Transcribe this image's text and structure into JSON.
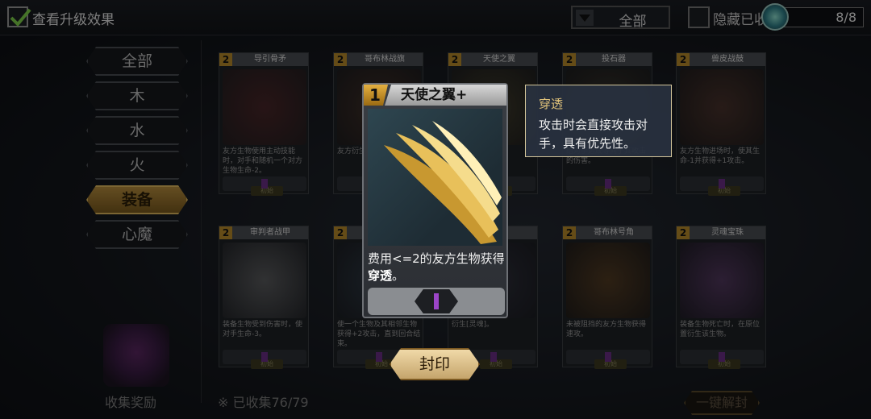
{
  "topbar": {
    "show_upgrade_label": "查看升级效果",
    "filter_value": "全部",
    "hide_label": "隐藏已收",
    "counter": "8/8"
  },
  "sidebar": {
    "items": [
      {
        "label": "全部"
      },
      {
        "label": "木"
      },
      {
        "label": "水"
      },
      {
        "label": "火"
      },
      {
        "label": "装备"
      },
      {
        "label": "心魔"
      }
    ]
  },
  "footer": {
    "chest_label": "收集奖励",
    "collected": "※ 已收集76/79",
    "unseal_all": "一键解封"
  },
  "cards": [
    {
      "cost": "2",
      "name": "导引骨矛",
      "desc": "友方生物使用主动技能时，对手和随机一个对方生物生命-2。",
      "tag": "初始"
    },
    {
      "cost": "2",
      "name": "哥布林战旗",
      "desc": "友方衍生...使其获...",
      "tag": "初始"
    },
    {
      "cost": "2",
      "name": "天使之翼",
      "desc": "...生物",
      "tag": "初始"
    },
    {
      "cost": "2",
      "name": "投石器",
      "desc": "给对手造成等同于其攻击的伤害。",
      "tag": "初始"
    },
    {
      "cost": "2",
      "name": "兽皮战鼓",
      "desc": "友方生物进场时，使其生命-1并获得+1攻击。",
      "tag": "初始"
    },
    {
      "cost": "2",
      "name": "审判者战甲",
      "desc": "装备生物受到伤害时，使对手生命-3。",
      "tag": "初始"
    },
    {
      "cost": "2",
      "name": "",
      "desc": "使一个生物及其相邻生物获得+2攻击，直到回合结束。",
      "tag": "初始"
    },
    {
      "cost": "2",
      "name": "",
      "desc": "衍生[灵魂]。",
      "tag": "初始"
    },
    {
      "cost": "2",
      "name": "哥布林号角",
      "desc": "未被阻挡的友方生物获得速攻。",
      "tag": "初始"
    },
    {
      "cost": "2",
      "name": "灵魂宝珠",
      "desc": "装备生物死亡时，在原位置衍生该生物。",
      "tag": "初始"
    }
  ],
  "focus_card": {
    "cost": "1",
    "title": "天使之翼+",
    "desc_pre": "费用<=2的友方生物获得",
    "desc_bold": "穿透",
    "desc_post": "。"
  },
  "tooltip": {
    "title": "穿透",
    "desc": "攻击时会直接攻击对手，具有优先性。"
  },
  "seal_button": "封印"
}
